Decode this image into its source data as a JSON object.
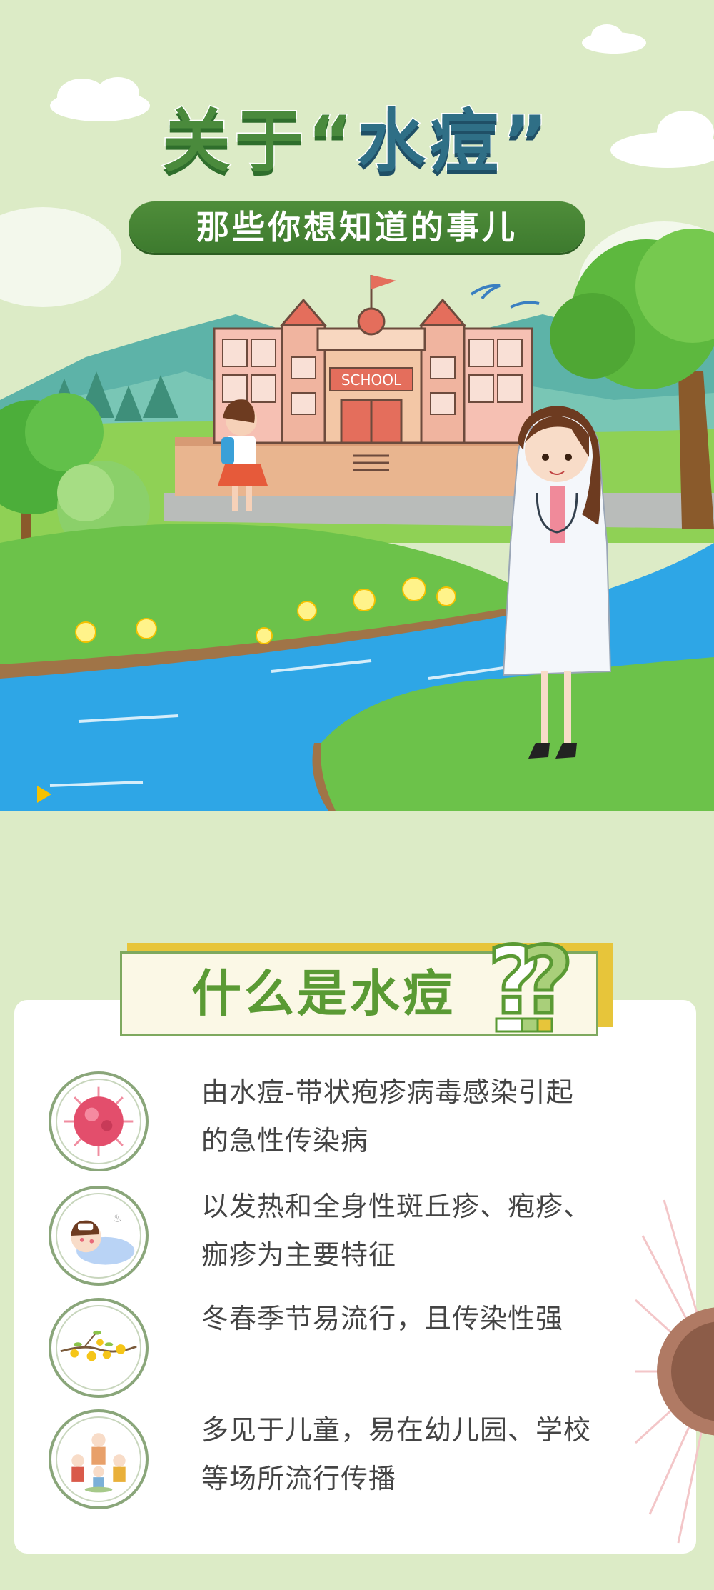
{
  "header": {
    "title_prefix": "关于“",
    "title_keyword": "水痘",
    "title_suffix": "”",
    "subtitle": "那些你想知道的事儿"
  },
  "illustration": {
    "school_sign": "SCHOOL"
  },
  "section": {
    "title": "什么是水痘",
    "items": [
      {
        "icon": "virus-icon",
        "lines": [
          "由水痘-带状疱疹病毒感染引起",
          "的急性传染病"
        ]
      },
      {
        "icon": "sick-child-icon",
        "lines": [
          "以发热和全身性斑丘疹、疱疹、",
          "痂疹为主要特征"
        ]
      },
      {
        "icon": "spring-flowers-icon",
        "lines": [
          "冬春季节易流行，且传染性强",
          ""
        ]
      },
      {
        "icon": "children-group-icon",
        "lines": [
          "多见于儿童，易在幼儿园、学校",
          "等场所流行传播"
        ]
      }
    ]
  },
  "colors": {
    "background": "#dcebc6",
    "accent_green": "#4f8d3a",
    "title_blue": "#2f6f86",
    "section_yellow": "#e7c53a"
  }
}
